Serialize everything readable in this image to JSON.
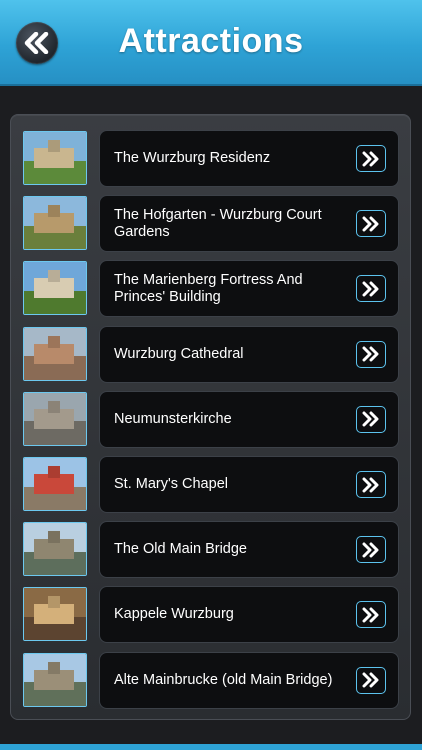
{
  "header": {
    "title": "Attractions",
    "back_icon": "double-chevron-left-icon",
    "color": "#2ea3d6"
  },
  "list": {
    "items": [
      {
        "label": "The Wurzburg Residenz",
        "thumb": {
          "sky": "#7fb2d8",
          "ground": "#5c8a3a",
          "bldg": "#c9b68f"
        }
      },
      {
        "label": "The Hofgarten - Wurzburg Court Gardens",
        "thumb": {
          "sky": "#8cb8dc",
          "ground": "#6a7f3c",
          "bldg": "#b79a6b"
        }
      },
      {
        "label": "The Marienberg Fortress And Princes' Building",
        "thumb": {
          "sky": "#6fa7d9",
          "ground": "#4f7a2e",
          "bldg": "#d8ccb2"
        }
      },
      {
        "label": "Wurzburg Cathedral",
        "thumb": {
          "sky": "#a6b8c8",
          "ground": "#8a6b55",
          "bldg": "#b88a6a"
        }
      },
      {
        "label": "Neumunsterkirche",
        "thumb": {
          "sky": "#9aa6ae",
          "ground": "#6d6a63",
          "bldg": "#a39a8c"
        }
      },
      {
        "label": "St. Mary's Chapel",
        "thumb": {
          "sky": "#9cc3e6",
          "ground": "#8a7a66",
          "bldg": "#c9483a"
        }
      },
      {
        "label": "The Old Main Bridge",
        "thumb": {
          "sky": "#b9cfe0",
          "ground": "#5d6e5c",
          "bldg": "#8f8670"
        }
      },
      {
        "label": "Kappele Wurzburg",
        "thumb": {
          "sky": "#8a6a45",
          "ground": "#5c4430",
          "bldg": "#d4b07a"
        }
      },
      {
        "label": "Alte Mainbrucke (old Main Bridge)",
        "thumb": {
          "sky": "#a8c8e4",
          "ground": "#60705a",
          "bldg": "#9b8f78"
        }
      }
    ],
    "arrow_icon": "double-chevron-right-icon",
    "accent": "#5cc3ee"
  }
}
